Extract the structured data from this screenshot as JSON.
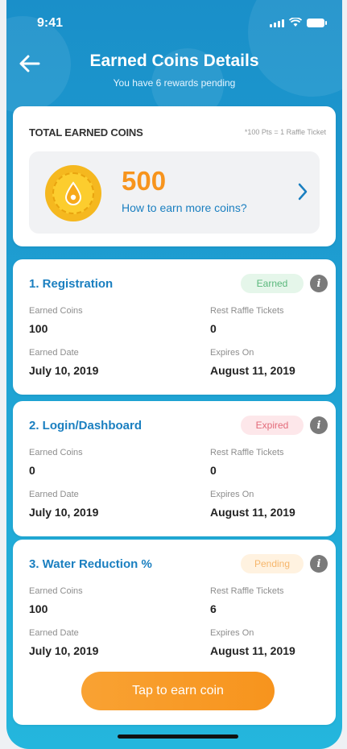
{
  "status_bar": {
    "time": "9:41"
  },
  "header": {
    "title": "Earned Coins Details",
    "subtitle": "You have 6 rewards pending"
  },
  "total": {
    "label": "TOTAL EARNED COINS",
    "note": "*100 Pts = 1 Raffle Ticket",
    "amount": "500",
    "link": "How to earn more coins?"
  },
  "rewards": [
    {
      "title": "1. Registration",
      "status": "Earned",
      "earned_coins_label": "Earned Coins",
      "earned_coins": "100",
      "raffle_label": "Rest Raffle Tickets",
      "raffle": "0",
      "earned_date_label": "Earned Date",
      "earned_date": "July 10, 2019",
      "expires_label": "Expires On",
      "expires": "August 11, 2019"
    },
    {
      "title": "2. Login/Dashboard",
      "status": "Expired",
      "earned_coins_label": "Earned Coins",
      "earned_coins": "0",
      "raffle_label": "Rest Raffle Tickets",
      "raffle": "0",
      "earned_date_label": "Earned Date",
      "earned_date": "July 10, 2019",
      "expires_label": "Expires On",
      "expires": "August 11, 2019"
    },
    {
      "title": "3. Water Reduction %",
      "status": "Pending",
      "earned_coins_label": "Earned Coins",
      "earned_coins": "100",
      "raffle_label": "Rest Raffle Tickets",
      "raffle": "6",
      "earned_date_label": "Earned Date",
      "earned_date": "July 10, 2019",
      "expires_label": "Expires On",
      "expires": "August 11, 2019"
    }
  ],
  "cta": {
    "label": "Tap to earn coin"
  },
  "icons": {
    "back": "arrow-left-icon",
    "coin": "coin-icon",
    "chevron": "chevron-right-icon",
    "info": "info-icon"
  },
  "colors": {
    "header_blue": "#1a8fc9",
    "accent_orange": "#f7941d",
    "link_blue": "#1a7fc0",
    "earned_green": "#5ab87c",
    "expired_red": "#e36b7a",
    "pending_orange": "#f6b66b"
  }
}
